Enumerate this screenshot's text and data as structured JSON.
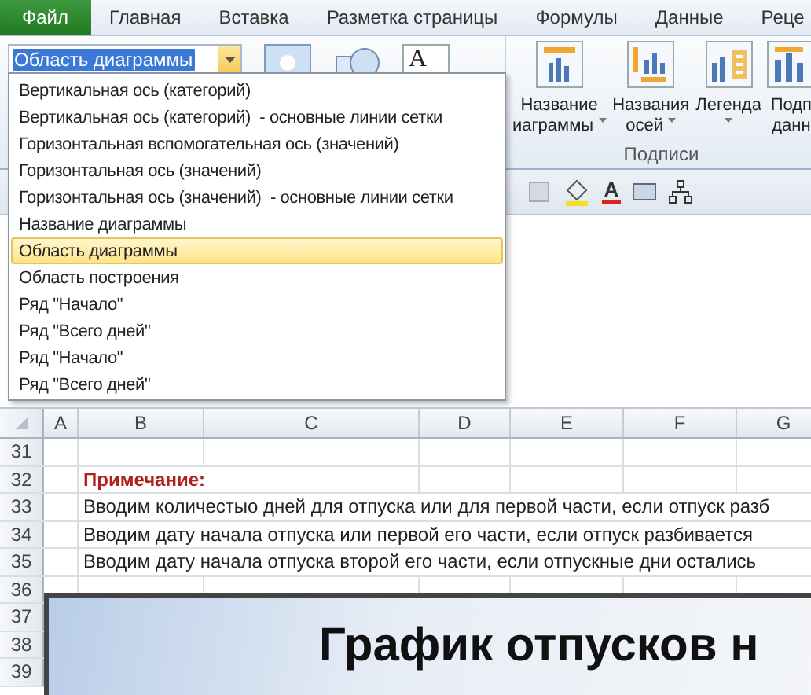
{
  "tabs": [
    {
      "label": "Файл",
      "kind": "file"
    },
    {
      "label": "Главная",
      "kind": "tab"
    },
    {
      "label": "Вставка",
      "kind": "tab"
    },
    {
      "label": "Разметка страницы",
      "kind": "tab"
    },
    {
      "label": "Формулы",
      "kind": "tab"
    },
    {
      "label": "Данные",
      "kind": "tab"
    },
    {
      "label": "Реце",
      "kind": "tab"
    }
  ],
  "name_box": {
    "value": "Область диаграммы"
  },
  "ribbon": {
    "text_box_glyph": "A",
    "group_label": "Подписи",
    "buttons": [
      {
        "lines": [
          "Название",
          "иаграммы"
        ],
        "dropdown": true
      },
      {
        "lines": [
          "Названия",
          "осей"
        ],
        "dropdown": true
      },
      {
        "lines": [
          "Легенда"
        ],
        "dropdown": true
      },
      {
        "lines": [
          "Подп",
          "данн"
        ],
        "dropdown": false
      }
    ]
  },
  "format_toolbar": {
    "font_color_glyph": "A"
  },
  "dropdown": {
    "items": [
      {
        "label": "Вертикальная ось (категорий)",
        "selected": false
      },
      {
        "label": "Вертикальная ось (категорий)  - основные линии сетки",
        "selected": false
      },
      {
        "label": "Горизонтальная вспомогательная ось (значений)",
        "selected": false
      },
      {
        "label": "Горизонтальная ось (значений)",
        "selected": false
      },
      {
        "label": "Горизонтальная ось (значений)  - основные линии сетки",
        "selected": false
      },
      {
        "label": "Название диаграммы",
        "selected": false
      },
      {
        "label": "Область диаграммы",
        "selected": true
      },
      {
        "label": "Область построения",
        "selected": false
      },
      {
        "label": "Ряд \"Начало\"",
        "selected": false
      },
      {
        "label": "Ряд \"Всего дней\"",
        "selected": false
      },
      {
        "label": "Ряд \"Начало\"",
        "selected": false
      },
      {
        "label": "Ряд \"Всего дней\"",
        "selected": false
      }
    ]
  },
  "sheet": {
    "columns": [
      "A",
      "B",
      "C",
      "D",
      "E",
      "F",
      "G"
    ],
    "rows": [
      {
        "number": "31"
      },
      {
        "number": "32",
        "text": "Примечание:",
        "kind": "note"
      },
      {
        "number": "33",
        "text": "Вводим количестыо дней для отпуска или для первой части, если отпуск разб",
        "kind": "text"
      },
      {
        "number": "34",
        "text": "Вводим дату начала отпуска или первой его части, если отпуск разбивается",
        "kind": "text"
      },
      {
        "number": "35",
        "text": "Вводим дату начала отпуска второй его части, если отпускные дни остались",
        "kind": "text"
      },
      {
        "number": "36"
      },
      {
        "number": "37"
      },
      {
        "number": "38"
      },
      {
        "number": "39"
      }
    ]
  },
  "chart": {
    "title": "График отпусков н"
  }
}
